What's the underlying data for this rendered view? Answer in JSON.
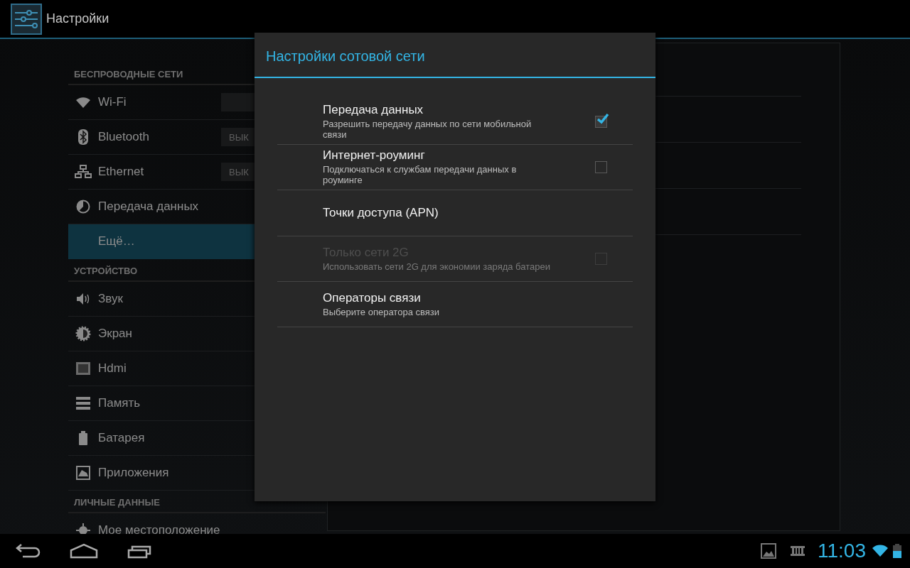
{
  "action_bar": {
    "title": "Настройки"
  },
  "sidebar": {
    "sections": [
      {
        "heading": "БЕСПРОВОДНЫЕ СЕТИ",
        "items": [
          {
            "label": "Wi-Fi",
            "kind": "switch",
            "selected": false
          },
          {
            "label": "Bluetooth",
            "kind": "switch",
            "switch_label": "ВЫК",
            "selected": false
          },
          {
            "label": "Ethernet",
            "kind": "switch",
            "switch_label": "ВЫК",
            "selected": false
          },
          {
            "label": "Передача данных",
            "kind": "plain",
            "selected": false
          },
          {
            "label": "Ещё…",
            "kind": "plain",
            "selected": true
          }
        ]
      },
      {
        "heading": "УСТРОЙСТВО",
        "items": [
          {
            "label": "Звук",
            "kind": "plain",
            "selected": false
          },
          {
            "label": "Экран",
            "kind": "plain",
            "selected": false
          },
          {
            "label": "Hdmi",
            "kind": "plain",
            "selected": false
          },
          {
            "label": "Память",
            "kind": "plain",
            "selected": false
          },
          {
            "label": "Батарея",
            "kind": "plain",
            "selected": false
          },
          {
            "label": "Приложения",
            "kind": "plain",
            "selected": false
          }
        ]
      },
      {
        "heading": "ЛИЧНЫЕ ДАННЫЕ",
        "items": [
          {
            "label": "Мое местоположение",
            "kind": "plain",
            "selected": false
          }
        ]
      }
    ]
  },
  "dialog": {
    "title": "Настройки сотовой сети",
    "rows": [
      {
        "kind": "checkbox",
        "title": "Передача данных",
        "summary": "Разрешить передачу данных по сети мобильной связи",
        "checked": true,
        "disabled": false
      },
      {
        "kind": "checkbox",
        "title": "Интернет-роуминг",
        "summary": "Подключаться к службам передачи данных в роуминге",
        "checked": false,
        "disabled": false
      },
      {
        "kind": "plain",
        "title": "Точки доступа (APN)",
        "disabled": false
      },
      {
        "kind": "checkbox",
        "title": "Только сети 2G",
        "summary": "Использовать сети 2G для экономии заряда батареи",
        "checked": false,
        "disabled": true
      },
      {
        "kind": "plain",
        "title": "Операторы связи",
        "summary": "Выберите оператора связи",
        "disabled": false
      }
    ]
  },
  "status_bar": {
    "time": "11:03"
  }
}
